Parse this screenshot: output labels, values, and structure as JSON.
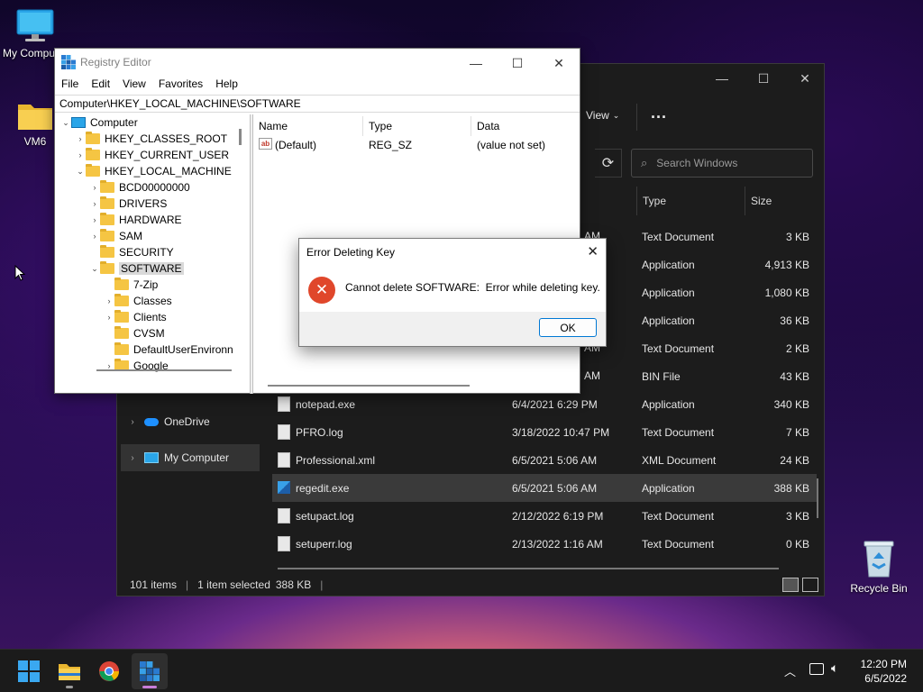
{
  "desktop": {
    "icons": [
      {
        "label": "My Computer"
      },
      {
        "label": "VM6"
      },
      {
        "label": "Recycle Bin"
      }
    ]
  },
  "explorer": {
    "view_label": "View",
    "more_label": "...",
    "search_placeholder": "Search Windows",
    "columns": {
      "type": "Type",
      "size": "Size"
    },
    "partial_dates": [
      "AM",
      "AM",
      "AM"
    ],
    "rows_hidden_behind": [
      {
        "type": "Text Document",
        "size": "3 KB"
      },
      {
        "type": "Application",
        "size": "4,913 KB"
      },
      {
        "type": "Application",
        "size": "1,080 KB"
      },
      {
        "type": "Application",
        "size": "36 KB"
      },
      {
        "type": "Text Document",
        "size": "2 KB"
      },
      {
        "type": "BIN File",
        "size": "43 KB"
      }
    ],
    "files": [
      {
        "name": "notepad.exe",
        "date": "6/4/2021 6:29 PM",
        "type": "Application",
        "size": "340 KB"
      },
      {
        "name": "PFRO.log",
        "date": "3/18/2022 10:47 PM",
        "type": "Text Document",
        "size": "7 KB"
      },
      {
        "name": "Professional.xml",
        "date": "6/5/2021 5:06 AM",
        "type": "XML Document",
        "size": "24 KB"
      },
      {
        "name": "regedit.exe",
        "date": "6/5/2021 5:06 AM",
        "type": "Application",
        "size": "388 KB"
      },
      {
        "name": "setupact.log",
        "date": "2/12/2022 6:19 PM",
        "type": "Text Document",
        "size": "3 KB"
      },
      {
        "name": "setuperr.log",
        "date": "2/13/2022 1:16 AM",
        "type": "Text Document",
        "size": "0 KB"
      }
    ],
    "nav": [
      {
        "label": "OneDrive"
      },
      {
        "label": "My Computer"
      }
    ],
    "status": {
      "items": "101 items",
      "selected": "1 item selected",
      "size": "388 KB"
    }
  },
  "regedit": {
    "title": "Registry Editor",
    "menu": [
      "File",
      "Edit",
      "View",
      "Favorites",
      "Help"
    ],
    "address": "Computer\\HKEY_LOCAL_MACHINE\\SOFTWARE",
    "tree": [
      {
        "label": "Computer"
      },
      {
        "label": "HKEY_CLASSES_ROOT"
      },
      {
        "label": "HKEY_CURRENT_USER"
      },
      {
        "label": "HKEY_LOCAL_MACHINE"
      },
      {
        "label": "BCD00000000"
      },
      {
        "label": "DRIVERS"
      },
      {
        "label": "HARDWARE"
      },
      {
        "label": "SAM"
      },
      {
        "label": "SECURITY"
      },
      {
        "label": "SOFTWARE"
      },
      {
        "label": "7-Zip"
      },
      {
        "label": "Classes"
      },
      {
        "label": "Clients"
      },
      {
        "label": "CVSM"
      },
      {
        "label": "DefaultUserEnvironn"
      },
      {
        "label": "Google"
      }
    ],
    "value_columns": {
      "name": "Name",
      "type": "Type",
      "data": "Data"
    },
    "values": [
      {
        "name": "(Default)",
        "type": "REG_SZ",
        "data": "(value not set)"
      }
    ]
  },
  "dialog": {
    "title": "Error Deleting Key",
    "message": "Cannot delete SOFTWARE:  Error while deleting key.",
    "ok_label": "OK"
  },
  "taskbar": {
    "time": "12:20 PM",
    "date": "6/5/2022"
  },
  "colors": {
    "accent": "#0078d4",
    "error_red": "#e0472b",
    "folder_yellow": "#f5c543"
  }
}
